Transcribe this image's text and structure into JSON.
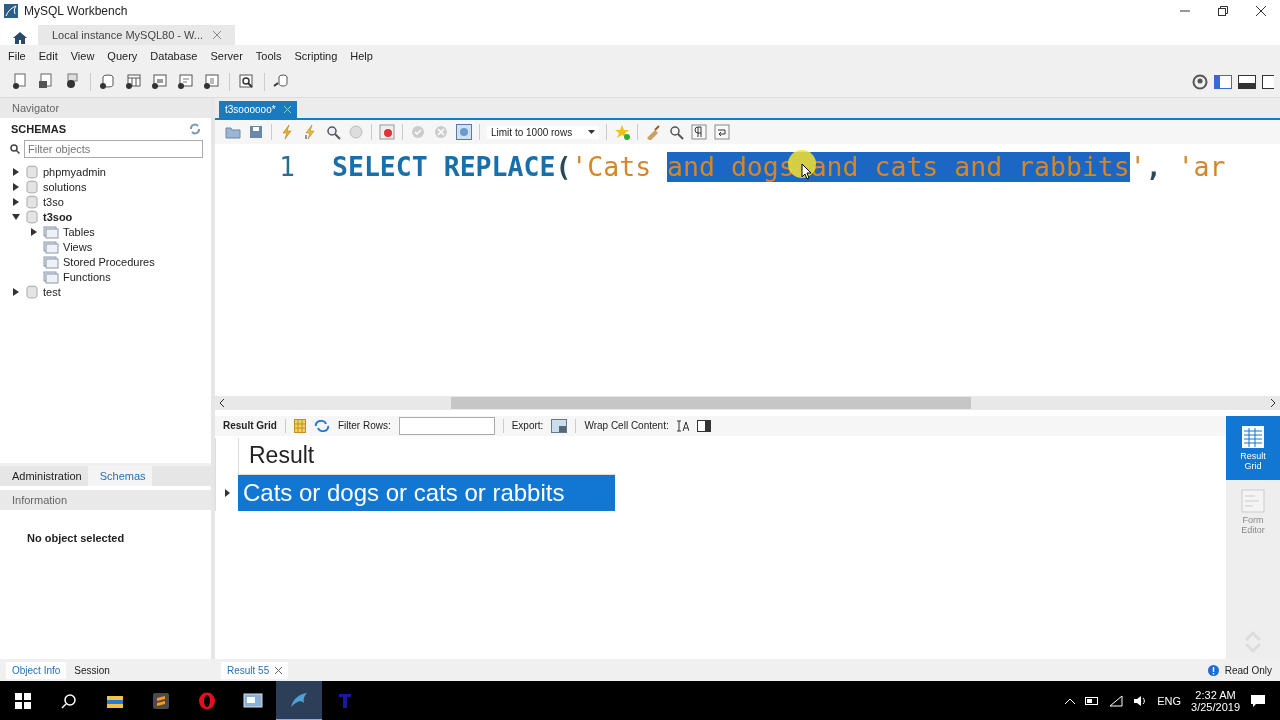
{
  "window": {
    "title": "MySQL Workbench"
  },
  "connection_tabs": [
    {
      "label": "Local instance MySQL80 - W...",
      "selected": true
    }
  ],
  "menu": [
    "File",
    "Edit",
    "View",
    "Query",
    "Database",
    "Server",
    "Tools",
    "Scripting",
    "Help"
  ],
  "navigator": {
    "title": "Navigator",
    "schemas_title": "SCHEMAS",
    "filter": {
      "placeholder": "Filter objects"
    },
    "tree": [
      {
        "label": "phpmyadmin",
        "kind": "schema",
        "default": false,
        "expanded": false
      },
      {
        "label": "solutions",
        "kind": "schema",
        "default": false,
        "expanded": false
      },
      {
        "label": "t3so",
        "kind": "schema",
        "default": false,
        "expanded": false
      },
      {
        "label": "t3soo",
        "kind": "schema",
        "default": true,
        "expanded": true,
        "children": [
          {
            "label": "Tables",
            "kind": "folder",
            "expanded": false
          },
          {
            "label": "Views",
            "kind": "folder"
          },
          {
            "label": "Stored Procedures",
            "kind": "folder"
          },
          {
            "label": "Functions",
            "kind": "folder"
          }
        ]
      },
      {
        "label": "test",
        "kind": "schema",
        "default": false,
        "expanded": false
      }
    ]
  },
  "sidebar_tabs": [
    {
      "label": "Administration",
      "selected": false
    },
    {
      "label": "Schemas",
      "selected": true
    }
  ],
  "information": {
    "title": "Information",
    "message": "No object selected"
  },
  "info_tabs": [
    {
      "label": "Object Info",
      "selected": true
    },
    {
      "label": "Session",
      "selected": false
    }
  ],
  "editor": {
    "tabs": [
      {
        "label": "t3soooooo*",
        "selected": true
      }
    ],
    "limit": "Limit to 1000 rows",
    "lines": [
      {
        "number": "1",
        "tokens": [
          {
            "text": "SELECT ",
            "kind": "keyword",
            "selected": false
          },
          {
            "text": "REPLACE",
            "kind": "keyword",
            "selected": false
          },
          {
            "text": "(",
            "kind": "punct",
            "selected": false
          },
          {
            "text": "'Cats ",
            "kind": "string",
            "selected": false
          },
          {
            "text": "and dogs and cats and rabbits",
            "kind": "string",
            "selected": true
          },
          {
            "text": "'",
            "kind": "string",
            "selected": false
          },
          {
            "text": ", ",
            "kind": "punct",
            "selected": false
          },
          {
            "text": "'ar",
            "kind": "string",
            "selected": false
          }
        ]
      }
    ]
  },
  "result": {
    "toolbar": {
      "result_grid": "Result Grid",
      "filter_label": "Filter Rows:",
      "export_label": "Export:",
      "wrap_label": "Wrap Cell Content:"
    },
    "columns": [
      "Result"
    ],
    "rows": [
      {
        "cells": [
          "Cats or dogs or cats or rabbits"
        ],
        "selected": true
      }
    ]
  },
  "side_panel": [
    {
      "label": "Result Grid",
      "selected": true
    },
    {
      "label": "Form Editor",
      "selected": false
    }
  ],
  "result_tabs": [
    {
      "label": "Result 55",
      "selected": true
    }
  ],
  "status": "Read Only",
  "taskbar": {
    "apps": [
      {
        "kind": "explorer",
        "selected": false
      },
      {
        "kind": "sublime",
        "selected": false
      },
      {
        "kind": "opera",
        "selected": false
      },
      {
        "kind": "app",
        "selected": false
      },
      {
        "kind": "workbench",
        "selected": true
      },
      {
        "kind": "text",
        "selected": false
      }
    ],
    "language": "ENG",
    "time": "2:32 AM",
    "date": "3/25/2019"
  }
}
